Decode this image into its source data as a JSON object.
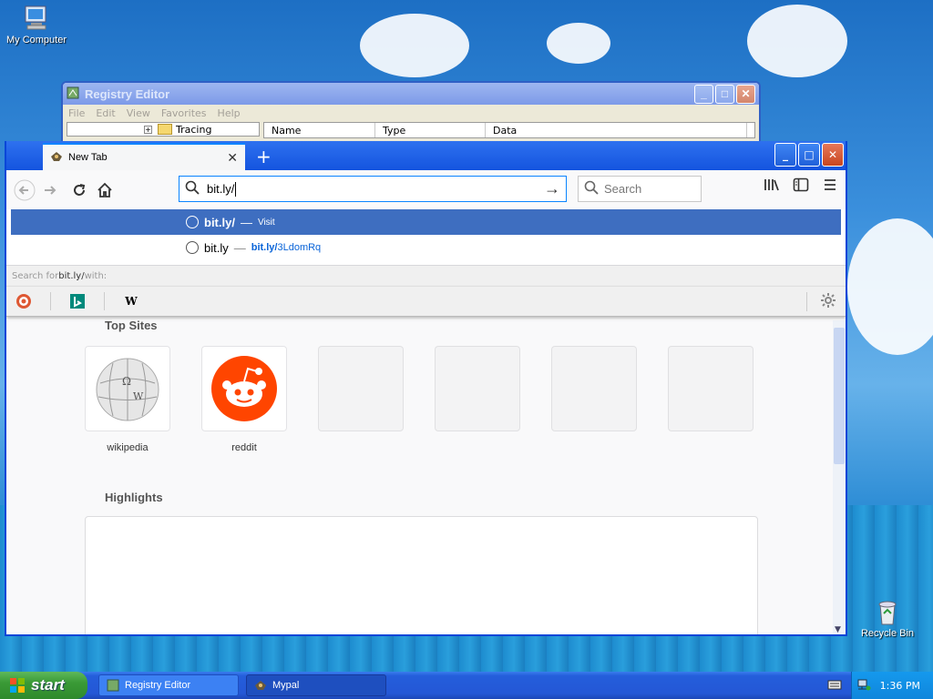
{
  "desktop": {
    "my_computer_label": "My Computer",
    "recycle_bin_label": "Recycle Bin"
  },
  "registry": {
    "title": "Registry Editor",
    "menu": [
      "File",
      "Edit",
      "View",
      "Favorites",
      "Help"
    ],
    "tree_item": "Tracing",
    "columns": [
      "Name",
      "Type",
      "Data"
    ]
  },
  "browser": {
    "tab_title": "New Tab",
    "url_value": "bit.ly/",
    "search_placeholder": "Search",
    "suggestions": [
      {
        "text": "bit.ly/",
        "dash": "—",
        "extra": "Visit",
        "selected": true
      },
      {
        "text": "bit.ly",
        "dash": "—",
        "extra_bold": "bit.ly/",
        "extra_rest": "3LdomRq",
        "selected": false
      }
    ],
    "search_with_prefix": "Search for ",
    "search_with_term": "bit.ly/",
    "search_with_suffix": " with:",
    "engines": [
      "duckduckgo-icon",
      "bing-icon",
      "wikipedia-icon"
    ],
    "top_sites_title": "Top Sites",
    "top_sites": [
      {
        "label": "wikipedia"
      },
      {
        "label": "reddit"
      }
    ],
    "highlights_title": "Highlights"
  },
  "taskbar": {
    "start_label": "start",
    "tasks": [
      {
        "label": "Registry Editor"
      },
      {
        "label": "Mypal"
      }
    ],
    "clock": "1:36 PM"
  },
  "colors": {
    "selected_suggestion": "#3e6ec0",
    "reddit": "#ff4500",
    "xp_title": "#2058d8"
  }
}
